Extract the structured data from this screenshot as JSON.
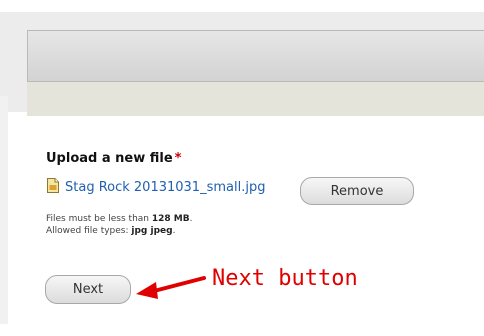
{
  "upload": {
    "label": "Upload a new file",
    "required_marker": "*",
    "file_name": "Stag Rock 20131031_small.jpg",
    "file_icon": "image-file-icon",
    "remove_label": "Remove",
    "help_line1_prefix": "Files must be less than ",
    "help_line1_value": "128 MB",
    "help_line1_suffix": ".",
    "help_line2_prefix": "Allowed file types: ",
    "help_line2_value": "jpg jpeg",
    "help_line2_suffix": "."
  },
  "actions": {
    "next_label": "Next"
  },
  "annotation": {
    "text": "Next button",
    "color": "#e00000"
  }
}
